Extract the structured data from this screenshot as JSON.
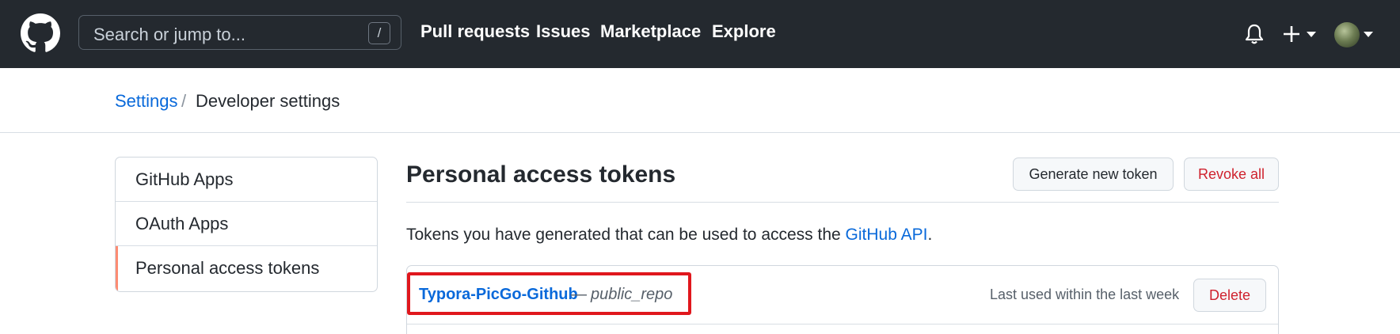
{
  "header": {
    "search_placeholder": "Search or jump to...",
    "search_shortcut": "/",
    "nav": {
      "pull_requests": "Pull requests",
      "issues": "Issues",
      "marketplace": "Marketplace",
      "explore": "Explore"
    },
    "icons": [
      "github-logo-icon",
      "bell-icon",
      "plus-icon",
      "caret-down-icon",
      "avatar"
    ],
    "background_color": "#24292f"
  },
  "breadcrumb": {
    "settings": "Settings",
    "separator": "/",
    "current": "Developer settings"
  },
  "sidebar": {
    "items": [
      {
        "label": "GitHub Apps"
      },
      {
        "label": "OAuth Apps"
      },
      {
        "label": "Personal access tokens"
      }
    ],
    "selected_index": 2,
    "selected_accent_color": "#fd8c73"
  },
  "main": {
    "title": "Personal access tokens",
    "generate_label": "Generate new token",
    "revoke_label": "Revoke all",
    "description": "Tokens you have generated that can be used to access the ",
    "description_link": "GitHub API",
    "description_end": ".",
    "tokens": [
      {
        "name": "Typora-PicGo-Github",
        "separator": "—",
        "scope": "public_repo",
        "last_used": "Last used within the last week",
        "delete_label": "Delete"
      }
    ]
  },
  "colors": {
    "link": "#0969da",
    "danger": "#cf222e",
    "highlight_box": "#e0171d"
  }
}
